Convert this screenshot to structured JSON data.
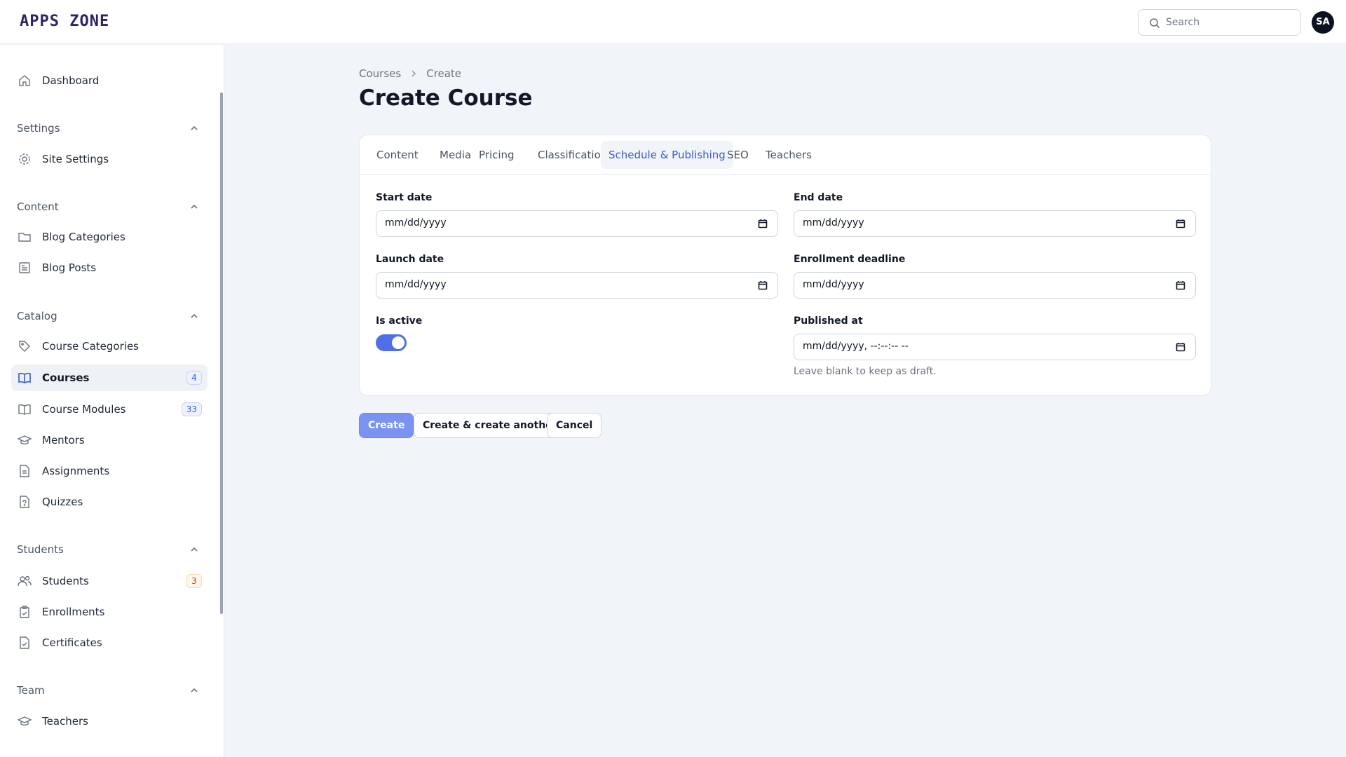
{
  "app": {
    "logo": "APPS ZONE"
  },
  "search": {
    "placeholder": "Search",
    "value": ""
  },
  "user": {
    "initials": "SA"
  },
  "sidebar": {
    "dashboard": "Dashboard",
    "groups": {
      "settings": {
        "title": "Settings",
        "items": {
          "site_settings": "Site Settings"
        }
      },
      "content": {
        "title": "Content",
        "items": {
          "blog_categories": "Blog Categories",
          "blog_posts": "Blog Posts"
        }
      },
      "catalog": {
        "title": "Catalog",
        "items": {
          "course_categories": "Course Categories",
          "courses": "Courses",
          "courses_badge": "4",
          "course_modules": "Course Modules",
          "course_modules_badge": "33",
          "mentors": "Mentors",
          "assignments": "Assignments",
          "quizzes": "Quizzes"
        }
      },
      "students": {
        "title": "Students",
        "items": {
          "students": "Students",
          "students_badge": "3",
          "enrollments": "Enrollments",
          "certificates": "Certificates"
        }
      },
      "team": {
        "title": "Team",
        "items": {
          "teachers": "Teachers"
        }
      }
    }
  },
  "breadcrumb": {
    "parent": "Courses",
    "current": "Create"
  },
  "page": {
    "title": "Create Course"
  },
  "tabs": [
    "Content",
    "Media",
    "Pricing",
    "Classification",
    "Schedule & Publishing",
    "SEO",
    "Teachers"
  ],
  "active_tab": "Schedule & Publishing",
  "form": {
    "start_date": {
      "label": "Start date",
      "value": "mm/dd/yyyy"
    },
    "end_date": {
      "label": "End date",
      "value": "mm/dd/yyyy"
    },
    "launch_date": {
      "label": "Launch date",
      "value": "mm/dd/yyyy"
    },
    "enrollment_deadline": {
      "label": "Enrollment deadline",
      "value": "mm/dd/yyyy"
    },
    "is_active": {
      "label": "Is active",
      "checked": true
    },
    "published_at": {
      "label": "Published at",
      "value": "mm/dd/yyyy, --:--:-- --",
      "hint": "Leave blank to keep as draft."
    }
  },
  "actions": {
    "create": "Create",
    "create_another": "Create & create another",
    "cancel": "Cancel"
  },
  "colors": {
    "accent": "#4f6ee8",
    "active_tab_text": "#3b5bcc",
    "logo": "#2c2566"
  }
}
